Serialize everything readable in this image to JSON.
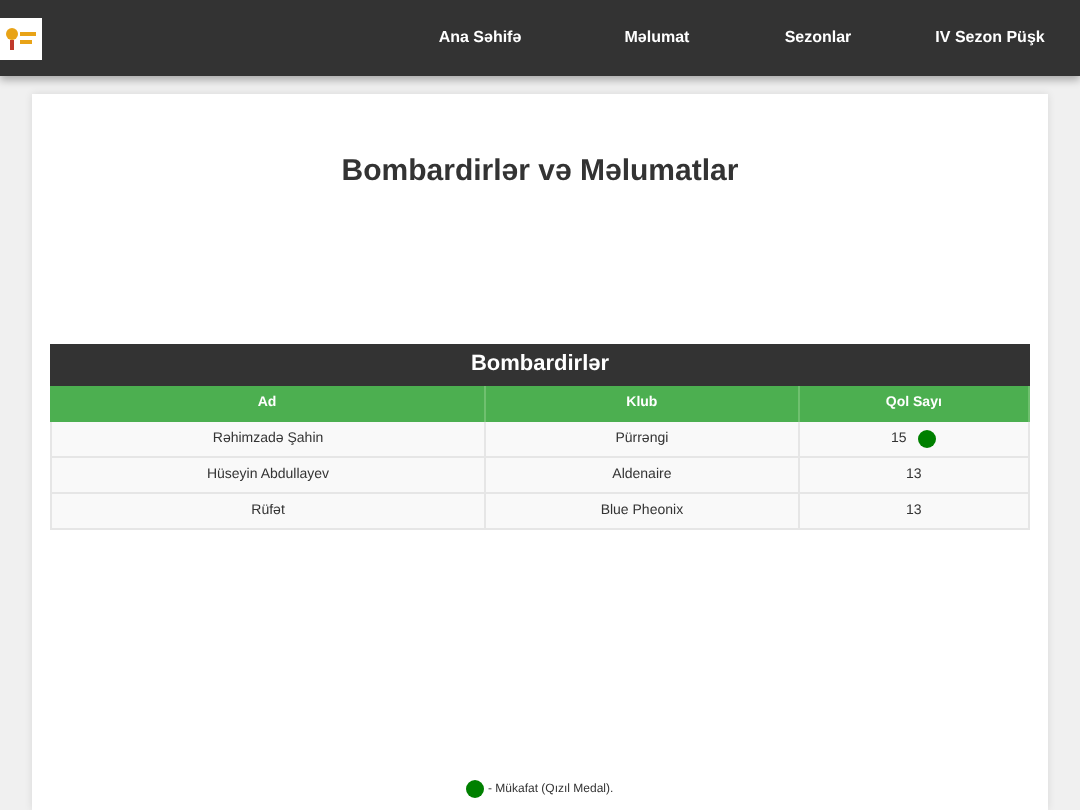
{
  "nav": [
    {
      "label": "Ana Səhifə"
    },
    {
      "label": "Məlumat"
    },
    {
      "label": "Sezonlar"
    },
    {
      "label": "IV Sezon Püşk"
    }
  ],
  "heading": "Bombardirlər və Məlumatlar",
  "table": {
    "title": "Bombardirlər",
    "columns": [
      "Ad",
      "Klub",
      "Qol Sayı"
    ],
    "rows": [
      {
        "name": "Rəhimzadə Şahin",
        "club": "Pürrəngi",
        "goals": "15",
        "award": true
      },
      {
        "name": "Hüseyin Abdullayev",
        "club": "Aldenaire",
        "goals": "13",
        "award": false
      },
      {
        "name": "Rüfət",
        "club": "Blue Pheonix",
        "goals": "13",
        "award": false
      }
    ]
  },
  "legend": "- Mükafat (Qızıl Medal)."
}
